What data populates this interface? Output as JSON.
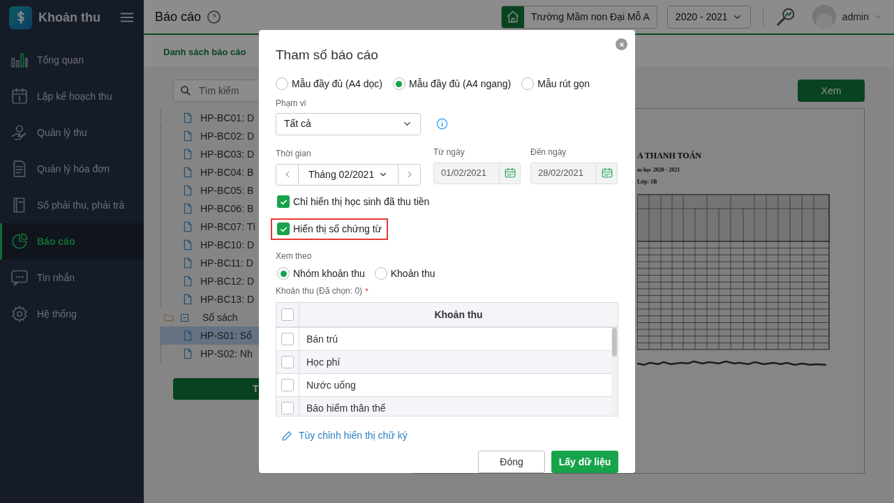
{
  "app": {
    "title": "Khoản thu"
  },
  "sidebar": {
    "items": [
      {
        "label": "Tổng quan",
        "selected": false
      },
      {
        "label": "Lập kế hoạch thu",
        "selected": false
      },
      {
        "label": "Quản lý thu",
        "selected": false
      },
      {
        "label": "Quản lý hóa đơn",
        "selected": false
      },
      {
        "label": "Sổ phải thu, phải trả",
        "selected": false
      },
      {
        "label": "Báo cáo",
        "selected": true
      },
      {
        "label": "Tin nhắn",
        "selected": false
      },
      {
        "label": "Hệ thống",
        "selected": false
      }
    ]
  },
  "header": {
    "title": "Báo cáo",
    "school": "Trường Mầm non Đại Mỗ A",
    "year": "2020 - 2021",
    "user": "admin"
  },
  "tabs": [
    {
      "label": "Danh sách báo cáo",
      "selected": true
    }
  ],
  "left_panel": {
    "search": {
      "placeholder": "Tìm kiếm"
    },
    "tree": [
      {
        "children": [
          {
            "label": "HP-BC01: D",
            "selected": false
          },
          {
            "label": "HP-BC02: D",
            "selected": false
          },
          {
            "label": "HP-BC03: D",
            "selected": false
          },
          {
            "label": "HP-BC04: B",
            "selected": false
          },
          {
            "label": "HP-BC05: B",
            "selected": false
          },
          {
            "label": "HP-BC06: B",
            "selected": false
          },
          {
            "label": "HP-BC07: Tì",
            "selected": false
          },
          {
            "label": "HP-BC10: D",
            "selected": false
          },
          {
            "label": "HP-BC11: D",
            "selected": false
          },
          {
            "label": "HP-BC12: D",
            "selected": false
          },
          {
            "label": "HP-BC13: D",
            "selected": false
          }
        ]
      },
      {
        "label": "Sổ sách",
        "expanded": true,
        "children": [
          {
            "label": "HP-S01: Sổ",
            "selected": true
          },
          {
            "label": "HP-S02: Nh",
            "selected": false
          }
        ]
      }
    ],
    "button": "T"
  },
  "right_panel": {
    "view_button": "Xem",
    "preview": {
      "title_lines": [
        "A THANH TOÁN",
        "m học 2020 - 2021",
        "Lớp: 1B"
      ]
    }
  },
  "dialog": {
    "title": "Tham số báo cáo",
    "templates": [
      {
        "label": "Mẫu đầy đủ (A4 dọc)",
        "selected": false
      },
      {
        "label": "Mẫu đầy đủ (A4 ngang)",
        "selected": true
      },
      {
        "label": "Mẫu rút gọn",
        "selected": false
      }
    ],
    "scope": {
      "label": "Phạm vi",
      "value": "Tất cả"
    },
    "period": {
      "label": "Thời gian",
      "value": "Tháng 02/2021"
    },
    "from": {
      "label": "Từ ngày",
      "value": "01/02/2021"
    },
    "to": {
      "label": "Đến ngày",
      "value": "28/02/2021"
    },
    "options": [
      {
        "label": "Chỉ hiển thị học sinh đã thu tiền",
        "checked": true,
        "highlighted": false
      },
      {
        "label": "Hiển thị số chứng từ",
        "checked": true,
        "highlighted": true
      }
    ],
    "view_by": {
      "label": "Xem theo",
      "options": [
        {
          "label": "Nhóm khoản thu",
          "selected": true
        },
        {
          "label": "Khoản thu",
          "selected": false
        }
      ]
    },
    "items_label": "Khoản thu (Đã chọn: 0)",
    "items_required_mark": "*",
    "table": {
      "header_checked": false,
      "column": "Khoản thu",
      "rows": [
        {
          "label": "Bán trú",
          "checked": false
        },
        {
          "label": "Học phí",
          "checked": false
        },
        {
          "label": "Nước uống",
          "checked": false
        },
        {
          "label": "Bảo hiểm thân thể",
          "checked": false
        }
      ]
    },
    "signature_link": "Tùy chỉnh hiển thị chữ ký",
    "buttons": [
      {
        "label": "Đóng",
        "kind": "secondary"
      },
      {
        "label": "Lấy dữ liệu",
        "kind": "primary"
      }
    ]
  }
}
